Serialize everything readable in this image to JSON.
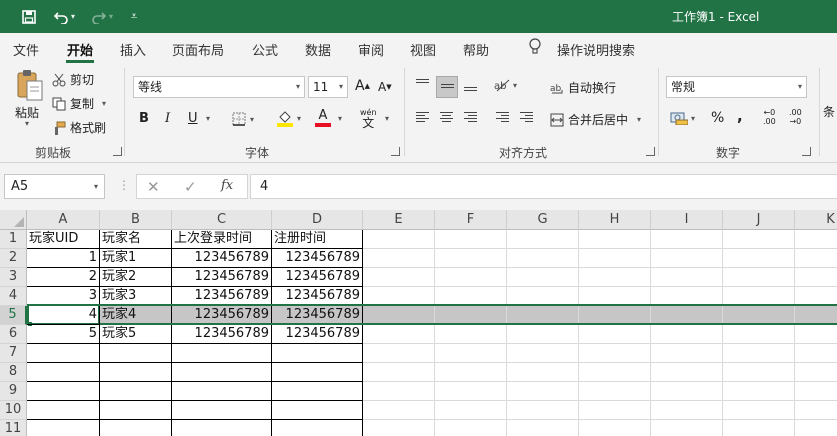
{
  "window": {
    "title": "工作簿1  -  Excel"
  },
  "tabs": [
    "文件",
    "开始",
    "插入",
    "页面布局",
    "公式",
    "数据",
    "审阅",
    "视图",
    "帮助"
  ],
  "tell_me": "操作说明搜索",
  "clipboard": {
    "paste": "粘贴",
    "cut": "剪切",
    "copy": "复制",
    "format_painter": "格式刷",
    "group_label": "剪贴板"
  },
  "font": {
    "name": "等线",
    "size": "11",
    "grow": "A",
    "shrink": "A",
    "bold": "B",
    "italic": "I",
    "underline": "U",
    "color_a": "A",
    "wen": "wén",
    "wen_char": "文",
    "group_label": "字体"
  },
  "alignment": {
    "wrap_text": "自动换行",
    "merge_center": "合并后居中",
    "group_label": "对齐方式"
  },
  "number": {
    "format": "常规",
    "percent": "%",
    "comma": ",",
    "inc_dec": ".00",
    "dec_dec": ".00",
    "group_label": "数字"
  },
  "styles": {
    "partial": "条"
  },
  "formula_bar": {
    "name_box": "A5",
    "value": "4",
    "fx": "fx"
  },
  "columns": [
    "A",
    "B",
    "C",
    "D",
    "E",
    "F",
    "G",
    "H",
    "I",
    "J",
    "K"
  ],
  "rows": [
    "1",
    "2",
    "3",
    "4",
    "5",
    "6",
    "7",
    "8",
    "9",
    "10",
    "11"
  ],
  "table": {
    "headers": [
      "玩家UID",
      "玩家名",
      "上次登录时间",
      "注册时间"
    ],
    "rows": [
      [
        "1",
        "玩家1",
        "123456789",
        "123456789"
      ],
      [
        "2",
        "玩家2",
        "123456789",
        "123456789"
      ],
      [
        "3",
        "玩家3",
        "123456789",
        "123456789"
      ],
      [
        "4",
        "玩家4",
        "123456789",
        "123456789"
      ],
      [
        "5",
        "玩家5",
        "123456789",
        "123456789"
      ]
    ]
  },
  "colors": {
    "brand": "#217346",
    "font_color": "#e81123",
    "highlight": "#ffe600"
  }
}
